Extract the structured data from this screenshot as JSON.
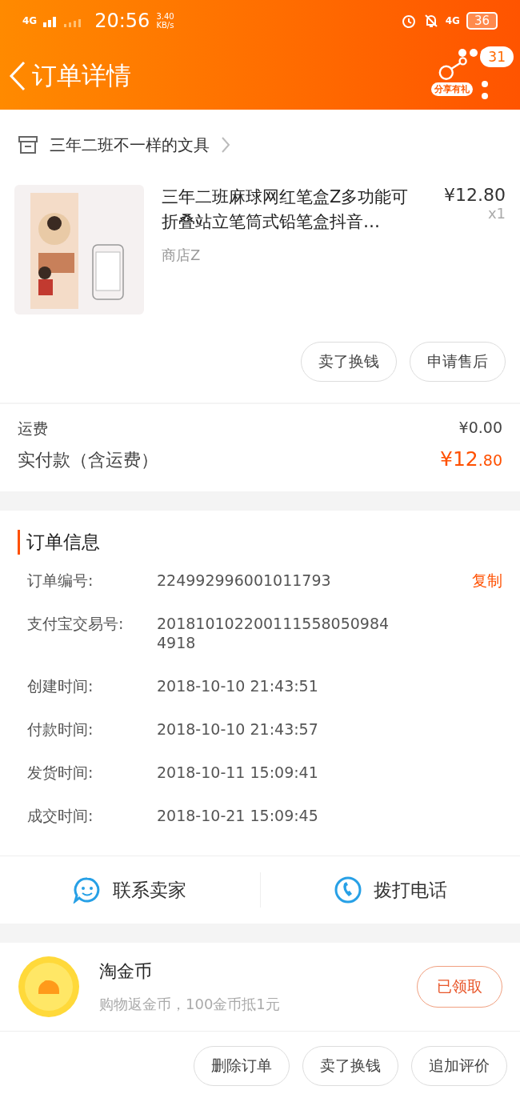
{
  "status_bar": {
    "network_left": "4G",
    "time": "20:56",
    "speed_value": "3.40",
    "speed_unit": "KB/s",
    "network_right": "4G",
    "battery": "36"
  },
  "header": {
    "title": "订单详情",
    "share_label": "分享有礼",
    "badge": "31"
  },
  "shop": {
    "name": "三年二班不一样的文具"
  },
  "product": {
    "kind": "picture",
    "title": "三年二班麻球网红笔盒Z多功能可折叠站立笔筒式铅笔盒抖音…",
    "price": "¥12.80",
    "quantity": "x1",
    "store": "商店Z"
  },
  "item_buttons": [
    "卖了换钱",
    "申请售后"
  ],
  "fees": [
    {
      "label": "运费",
      "value": "¥0.00"
    }
  ],
  "total": {
    "label": "实付款（含运费）",
    "main": "¥12",
    "decimal": ".80"
  },
  "order_info": {
    "title": "订单信息",
    "rows": [
      {
        "label": "订单编号:",
        "value": "224992996001011793",
        "action": "复制"
      },
      {
        "label": "支付宝交易号:",
        "value": "2018101022001115580509844918"
      },
      {
        "label": "创建时间:",
        "value": "2018-10-10 21:43:51"
      },
      {
        "label": "付款时间:",
        "value": "2018-10-10 21:43:57"
      },
      {
        "label": "发货时间:",
        "value": "2018-10-11 15:09:41"
      },
      {
        "label": "成交时间:",
        "value": "2018-10-21 15:09:45"
      }
    ]
  },
  "contact": [
    {
      "kind": "chat",
      "label": "联系卖家"
    },
    {
      "kind": "phone",
      "label": "拨打电话"
    }
  ],
  "coins": {
    "title": "淘金币",
    "subtitle": "购物返金币，100金币抵1元",
    "button": "已领取"
  },
  "bottom_buttons": [
    "删除订单",
    "卖了换钱",
    "追加评价"
  ]
}
